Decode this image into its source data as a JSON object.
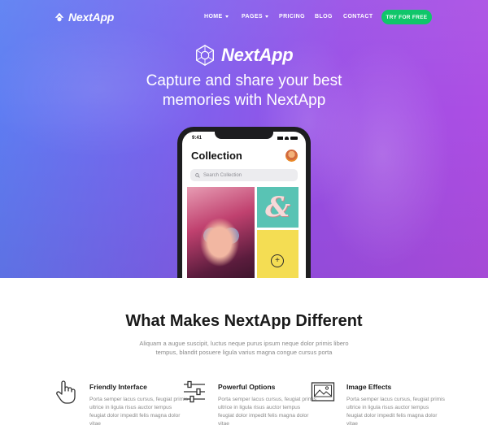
{
  "nav": {
    "logo_text": "NextApp",
    "items": [
      {
        "label": "HOME",
        "has_dropdown": true
      },
      {
        "label": "PAGES",
        "has_dropdown": true
      },
      {
        "label": "PRICING",
        "has_dropdown": false
      },
      {
        "label": "BLOG",
        "has_dropdown": false
      },
      {
        "label": "CONTACT",
        "has_dropdown": false
      }
    ],
    "cta_label": "TRY FOR FREE"
  },
  "hero": {
    "brand": "NextApp",
    "headline_line1": "Capture and share your best",
    "headline_line2": "memories with NextApp"
  },
  "phone": {
    "time": "9:41",
    "title": "Collection",
    "search_placeholder": "Search Collection",
    "tile_letter": "&",
    "add_button": "+"
  },
  "features_section": {
    "title": "What Makes NextApp Different",
    "subtitle": "Aliquam a augue suscipit, luctus neque purus ipsum neque dolor primis libero tempus, blandit posuere ligula varius magna congue cursus porta",
    "items": [
      {
        "icon": "hand-pointer-icon",
        "title": "Friendly Interface",
        "description": "Porta semper lacus cursus, feugiat primis ultrice in ligula risus auctor tempus feugiat dolor impedit felis magna dolor vitae"
      },
      {
        "icon": "sliders-icon",
        "title": "Powerful Options",
        "description": "Porta semper lacus cursus, feugiat primis ultrice in ligula risus auctor tempus feugiat dolor impedit felis magna dolor vitae"
      },
      {
        "icon": "image-icon",
        "title": "Image Effects",
        "description": "Porta semper lacus cursus, feugiat primis ultrice in ligula risus auctor tempus feugiat dolor impedit felis magna dolor vitae"
      }
    ]
  },
  "colors": {
    "accent_green": "#10c66a",
    "hero_gradient_start": "#5b7ff2",
    "hero_gradient_end": "#b04ee3",
    "tile_teal": "#59c3b4",
    "tile_yellow": "#f4dd53"
  }
}
